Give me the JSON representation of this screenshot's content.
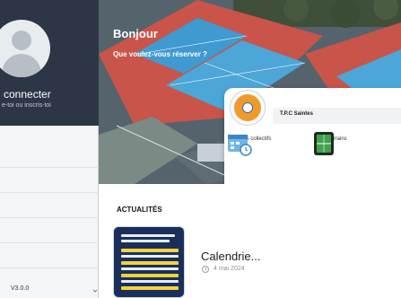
{
  "sidebar": {
    "login_title": "connecter",
    "login_subtitle": "e-toi ou inscris-toi",
    "version": "V3.0.0",
    "scroll_icon": "chevron-down-icon"
  },
  "hero": {
    "greeting": "Bonjour",
    "question": "Que voulez-vous réserver ?"
  },
  "club": {
    "name": "T.P.C Saintes",
    "actions": [
      {
        "label": "Cours collectifs",
        "icon": "calendar-clock-icon"
      },
      {
        "label": "Terrains",
        "icon": "court-icon"
      }
    ]
  },
  "news": {
    "section_title": "ACTUALITÉS",
    "items": [
      {
        "headline": "Calendrie...",
        "date": "4 mai 2024",
        "date_icon": "clock-icon"
      }
    ]
  },
  "colors": {
    "sidebar_header": "#2c3646",
    "accent_orange": "#f19a2c",
    "court_blue": "#3f9ad0",
    "court_red": "#c9544a"
  }
}
